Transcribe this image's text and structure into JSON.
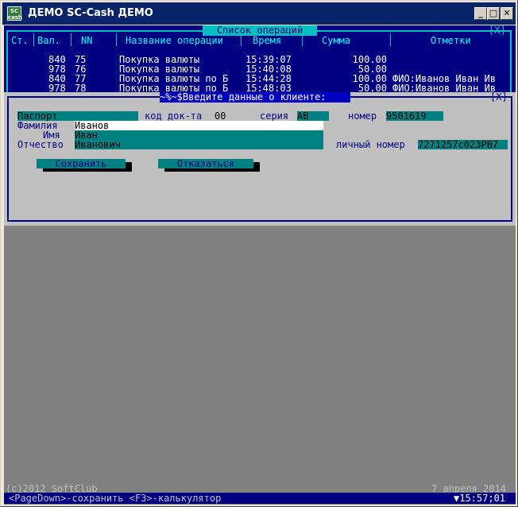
{
  "window": {
    "title": "ДЕМО SC-Cash ДЕМО",
    "icon_text": "SC\ncash",
    "min_glyph": "_",
    "max_glyph": "□",
    "close_glyph": "✕"
  },
  "ops_list": {
    "title": "Список операций",
    "close_mark": "[X]",
    "columns": [
      "Ст.",
      "Вал.",
      "NN",
      "Название операции",
      "Время",
      "Сумма",
      "Отметки"
    ],
    "rows": [
      {
        "cur": "840",
        "nn": "75",
        "name": "Покупка валюты",
        "time": "15:39:07",
        "sum": "100.00",
        "note": ""
      },
      {
        "cur": "978",
        "nn": "76",
        "name": "Покупка валюты",
        "time": "15:40:08",
        "sum": "50.00",
        "note": ""
      },
      {
        "cur": "840",
        "nn": "77",
        "name": "Покупка валюты по Б",
        "time": "15:44:28",
        "sum": "100.00",
        "note": "ФИО:Иванов Иван Ив"
      },
      {
        "cur": "978",
        "nn": "78",
        "name": "Покупка валюты по Б",
        "time": "15:48:03",
        "sum": "50.00",
        "note": "ФИО:Иванов Иван Ив"
      }
    ]
  },
  "client_dialog": {
    "title": "~%~$Введите данные о клиенте:",
    "close_mark": "[X]",
    "doc_type": "Паспорт",
    "doc_code_label": "код док-та",
    "doc_code": "00",
    "series_label": "серия",
    "series": "АВ",
    "number_label": "номер",
    "number": "9501619",
    "surname_label": "Фамилия",
    "surname": "Иванов",
    "name_label": "Имя",
    "name": "Иван",
    "patronymic_label": "Отчество",
    "patronymic": "Иванович",
    "personal_number_label": "личный номер",
    "personal_number": "7271257c023PB7",
    "save_label": "Сохранить",
    "cancel_label": "Отказаться"
  },
  "footer": {
    "copyright": "(c)2012 SoftClub",
    "date": "7 апреля 2014",
    "hints": "<PageDown>-сохранить <F3>-калькулятор",
    "clock": "▼15:57;01"
  }
}
